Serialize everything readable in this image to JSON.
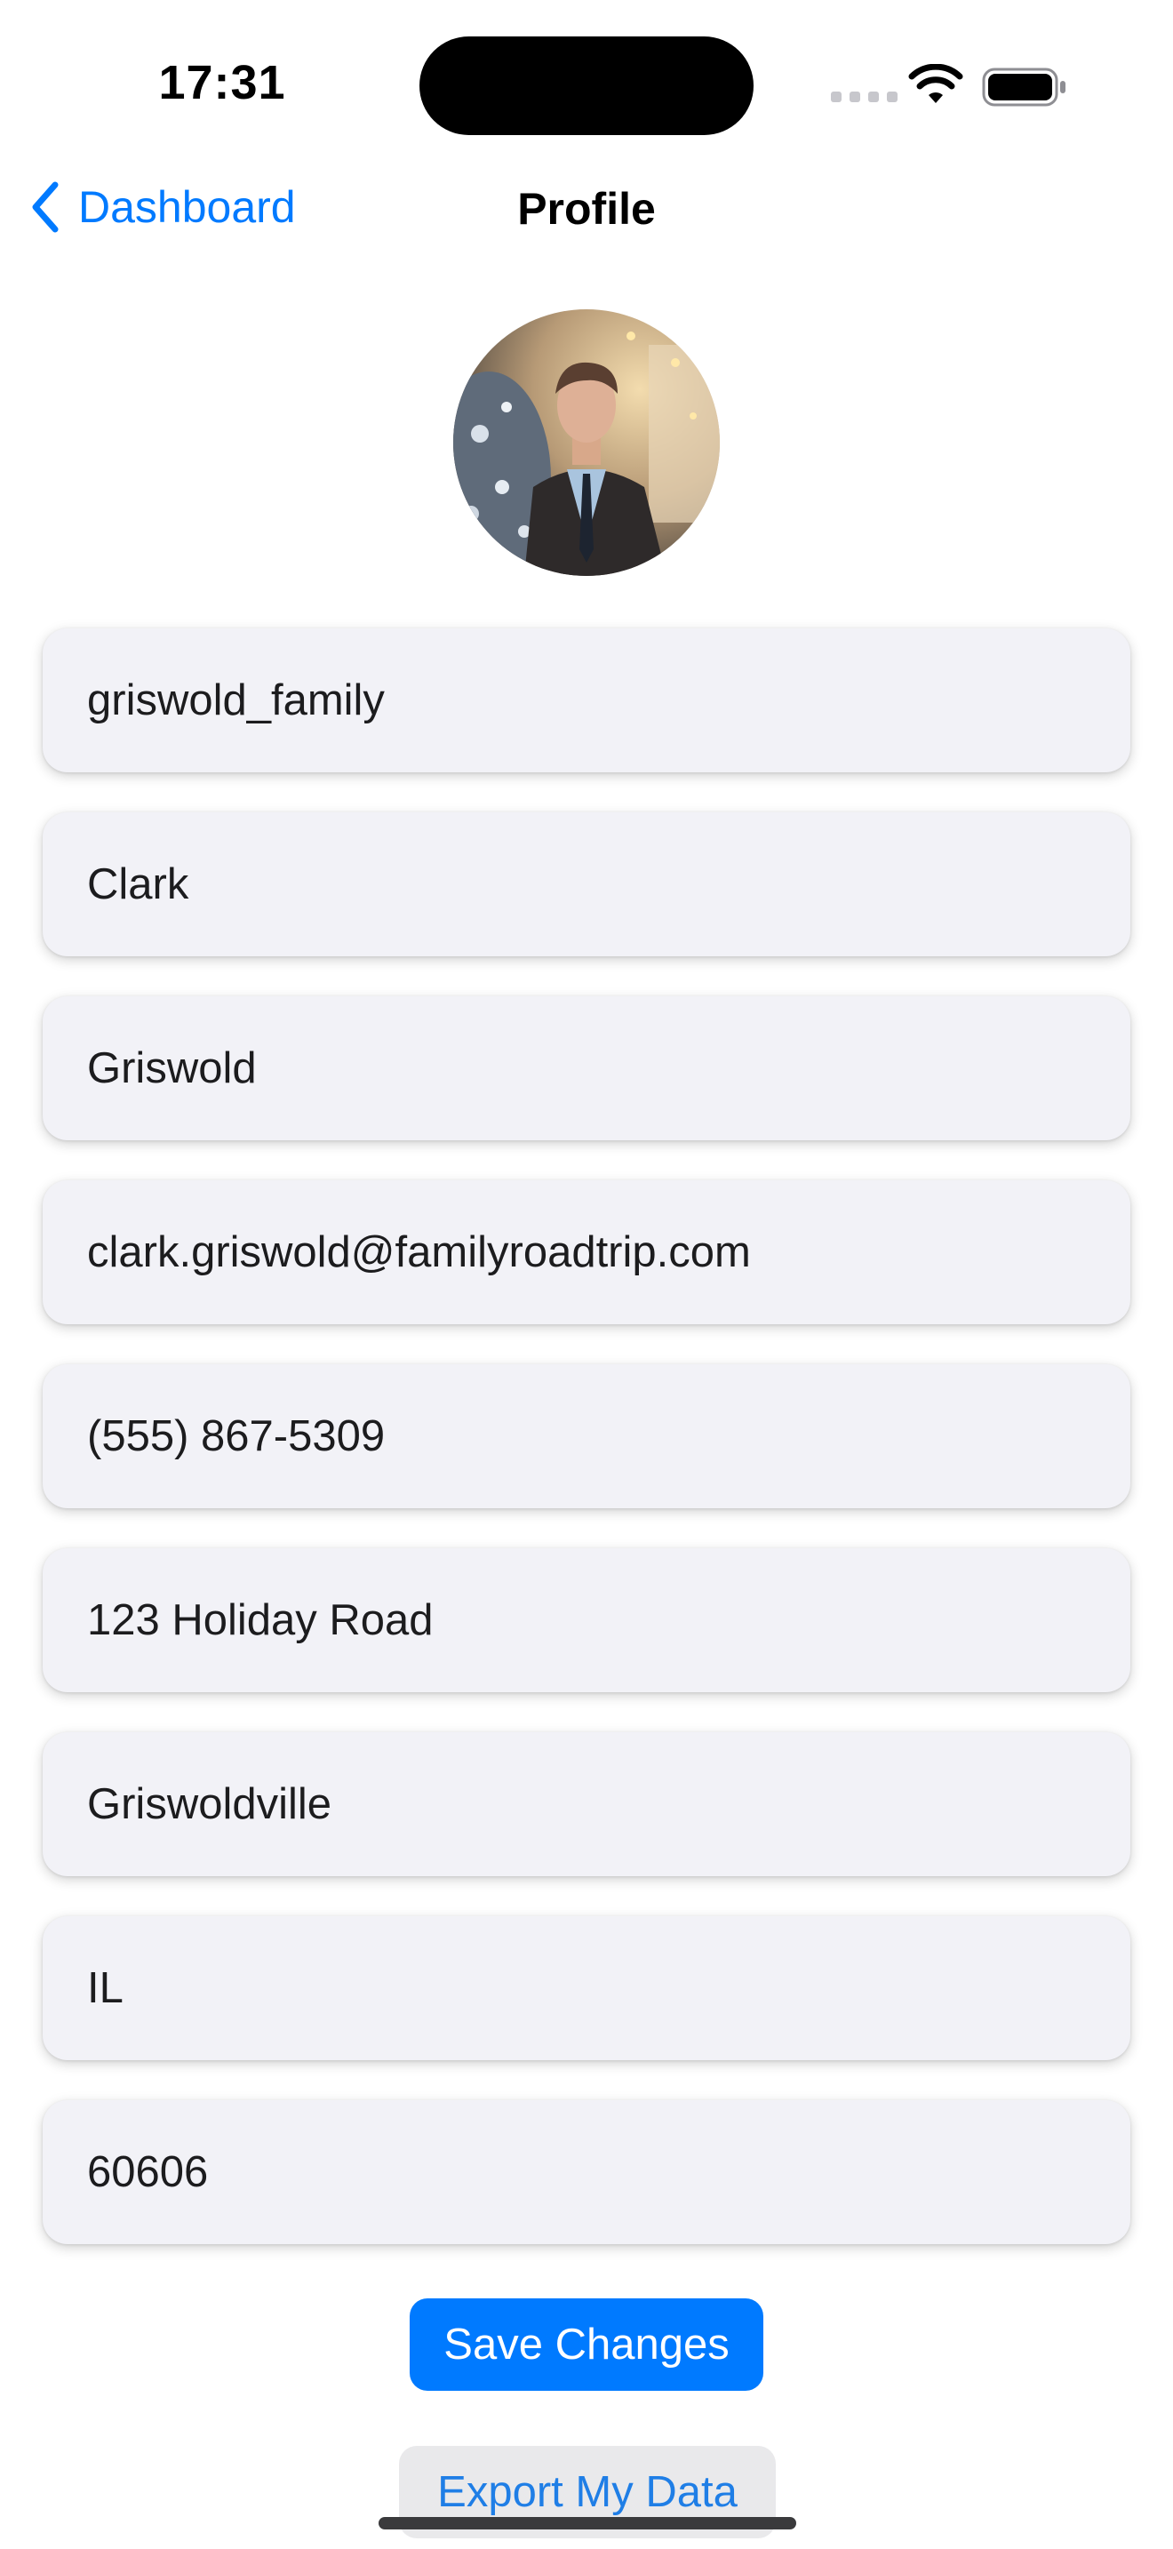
{
  "status_bar": {
    "time": "17:31"
  },
  "nav": {
    "back_label": "Dashboard",
    "title": "Profile"
  },
  "avatar": {
    "description_icon": "profile-photo"
  },
  "form": {
    "fields": [
      {
        "name": "username-field",
        "value": "griswold_family"
      },
      {
        "name": "first-name-field",
        "value": "Clark"
      },
      {
        "name": "last-name-field",
        "value": "Griswold"
      },
      {
        "name": "email-field",
        "value": "clark.griswold@familyroadtrip.com"
      },
      {
        "name": "phone-field",
        "value": "(555) 867-5309"
      },
      {
        "name": "address-field",
        "value": "123 Holiday Road"
      },
      {
        "name": "city-field",
        "value": "Griswoldville"
      },
      {
        "name": "state-field",
        "value": "IL"
      },
      {
        "name": "zip-field",
        "value": "60606"
      }
    ]
  },
  "actions": {
    "save_label": "Save Changes",
    "export_label": "Export My Data"
  },
  "colors": {
    "accent": "#007aff",
    "field_background": "#f2f2f7",
    "secondary_button": "#e9e9eb"
  }
}
